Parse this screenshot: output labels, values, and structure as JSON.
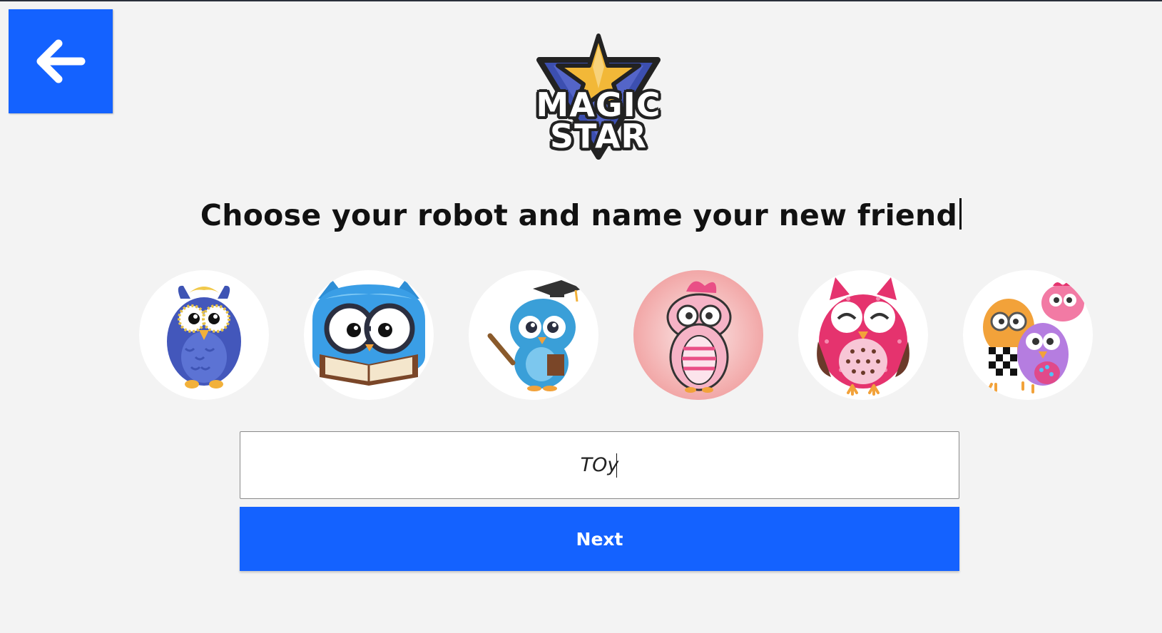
{
  "header": {
    "back_button_icon": "arrow-left-icon",
    "logo": {
      "line1": "MAGIC",
      "line2": "STAR"
    }
  },
  "headline": "Choose your robot and name your new friend",
  "robots": [
    {
      "icon": "blue-owl-icon"
    },
    {
      "icon": "reading-owl-icon"
    },
    {
      "icon": "graduate-owl-icon"
    },
    {
      "icon": "pink-owl-icon"
    },
    {
      "icon": "polka-dot-owl-icon"
    },
    {
      "icon": "owl-family-icon"
    }
  ],
  "name_input": {
    "value": "TOy"
  },
  "next_button": {
    "label": "Next"
  },
  "colors": {
    "accent": "#1462ff",
    "background": "#f3f3f3"
  }
}
